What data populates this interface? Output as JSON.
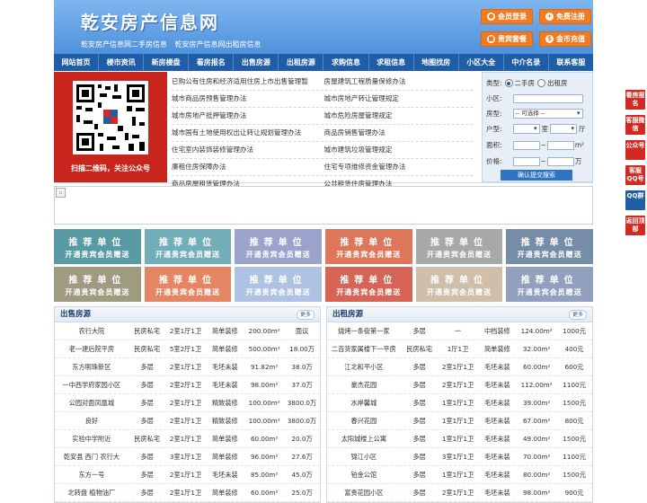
{
  "header": {
    "logo": "乾安房产信息网",
    "subtitle": "乾安房产信息网二手房信息 乾安房产信息网出租房信息",
    "buttons": [
      {
        "label": "会员登录",
        "icon": "user-icon"
      },
      {
        "label": "免费注册",
        "icon": "user-add-icon"
      },
      {
        "label": "贵宾套餐",
        "icon": "gift-icon"
      },
      {
        "label": "金币充值",
        "icon": "coin-icon"
      }
    ]
  },
  "nav": [
    "网站首页",
    "楼市资讯",
    "新房楼盘",
    "看房报名",
    "出售房源",
    "出租房源",
    "求购信息",
    "求租信息",
    "地图找房",
    "小区大全",
    "中介名录",
    "联系客服"
  ],
  "qr": {
    "caption": "扫描二维码，关注公众号"
  },
  "links": [
    [
      "已购公有住房和经济适用住房上市出售管理暂",
      "房屋建筑工程质量保修办法"
    ],
    [
      "城市商品房预售管理办法",
      "城市房地产转让管理规定"
    ],
    [
      "城市房地产抵押管理办法",
      "城市危险房屋管理规定"
    ],
    [
      "城市国有土地使用权出让转让规划管理办法",
      "商品房销售管理办法"
    ],
    [
      "住宅室内装饰装修管理办法",
      "城市建筑垃圾管理规定"
    ],
    [
      "廉租住房保障办法",
      "住宅专项维修资金管理办法"
    ],
    [
      "商品房屋租赁管理办法",
      "公共租赁住房管理办法"
    ]
  ],
  "search": {
    "type_label": "类型:",
    "type_opt1": "二手房",
    "type_opt2": "出租房",
    "community_label": "小区:",
    "house_label": "房型:",
    "house_select": "-- 可选择 --",
    "layout_label": "户型:",
    "room_unit": "室",
    "hall_unit": "厅",
    "area_label": "面积:",
    "area_unit": "m²",
    "price_label": "价格:",
    "price_unit": "万",
    "submit": "确认提交搜索"
  },
  "rec": {
    "line1": "推荐单位",
    "line2": "开通贵宾会员赠送"
  },
  "rec_colors": [
    "#3d8a95",
    "#5aa0ad",
    "#8a94c4",
    "#d9603d",
    "#9a9a9a",
    "#5f7a9a",
    "#8f8a6a",
    "#e0704a",
    "#a3b8e0",
    "#d04b3a",
    "#c8b49a",
    "#7f8fb5"
  ],
  "sale": {
    "title": "出售房源",
    "more": "更多",
    "rows": [
      [
        "农行大院",
        "民房私宅",
        "2室1厅1卫",
        "简单装修",
        "200.00m²",
        "面议"
      ],
      [
        "老一建后院平房",
        "民房私宅",
        "5室2厅1卫",
        "简单装修",
        "500.00m²",
        "18.00万"
      ],
      [
        "东方明珠新区",
        "多层",
        "2室1厅1卫",
        "毛坯未装",
        "91.82m²",
        "38.0万"
      ],
      [
        "一中西学府家园小区",
        "多层",
        "2室2厅1卫",
        "毛坯未装",
        "98.00m²",
        "37.0万"
      ],
      [
        "公园对面凤凰城",
        "多层",
        "2室1厅1卫",
        "精致装修",
        "100.00m²",
        "3800.0万"
      ],
      [
        "良好",
        "多层",
        "2室1厅1卫",
        "精致装修",
        "100.00m²",
        "3800.0万"
      ],
      [
        "实验中学附近",
        "民房私宅",
        "2室1厅1卫",
        "简单装修",
        "60.00m²",
        "20.0万"
      ],
      [
        "乾安县 西门 农行大",
        "多层",
        "3室1厅1卫",
        "简单装修",
        "96.00m²",
        "27.6万"
      ],
      [
        "东方一号",
        "多层",
        "2室1厅1卫",
        "毛坯未装",
        "85.00m²",
        "45.0万"
      ],
      [
        "北转盘 植物油厂",
        "多层",
        "2室1厅1卫",
        "简单装修",
        "60.00m²",
        "25.0万"
      ]
    ]
  },
  "rent": {
    "title": "出租房源",
    "more": "更多",
    "rows": [
      [
        "烧烤一条街第一家",
        "多层",
        "一",
        "中档装修",
        "124.00m²",
        "1000元"
      ],
      [
        "二百货家属楼下一平房",
        "民房私宅",
        "1厅1卫",
        "简单装修",
        "32.00m²",
        "400元"
      ],
      [
        "江北和平小区",
        "多层",
        "2室1厅1卫",
        "毛坯未装",
        "60.00m²",
        "600元"
      ],
      [
        "豪杰花园",
        "多层",
        "2室1厅1卫",
        "毛坯未装",
        "112.00m²",
        "1100元"
      ],
      [
        "水岸馨城",
        "多层",
        "1室1厅1卫",
        "毛坯未装",
        "39.00m²",
        "1500元"
      ],
      [
        "春兴花园",
        "多层",
        "1室1厅1卫",
        "毛坯未装",
        "67.00m²",
        "800元"
      ],
      [
        "太阳城楼上公寓",
        "多层",
        "1室1厅1卫",
        "毛坯未装",
        "49.00m²",
        "1500元"
      ],
      [
        "锦江小区",
        "多层",
        "3室1厅1卫",
        "毛坯未装",
        "70.00m²",
        "1100元"
      ],
      [
        "铂金公馆",
        "多层",
        "1室1厅1卫",
        "毛坯未装",
        "80.00m²",
        "1500元"
      ],
      [
        "富贵花园小区",
        "多层",
        "2室1厅1卫",
        "毛坯未装",
        "98.00m²",
        "900元"
      ]
    ]
  },
  "side": [
    "看房报名",
    "客服微信",
    "公众号",
    "客服QQ号",
    "QQ群",
    "返回顶部"
  ]
}
